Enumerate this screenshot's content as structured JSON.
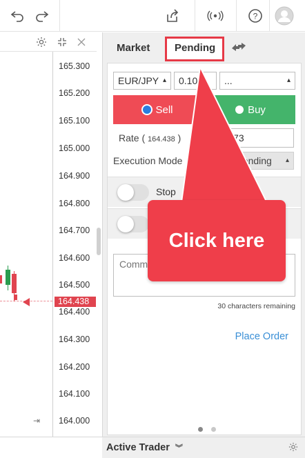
{
  "topbar": {
    "undo_icon": "undo-icon",
    "redo_icon": "redo-icon",
    "share_icon": "share-icon",
    "broadcast_icon": "broadcast-icon",
    "help_icon": "help-icon",
    "avatar_icon": "avatar-icon"
  },
  "chart": {
    "settings_icon": "gear-icon",
    "collapse_icon": "collapse-icon",
    "close_icon": "close-icon",
    "price_ticks": [
      "165.300",
      "165.200",
      "165.100",
      "165.000",
      "164.900",
      "164.800",
      "164.700",
      "164.600",
      "164.500",
      "164.400",
      "164.300",
      "164.200",
      "164.100",
      "164.000"
    ],
    "current_price": "164.438",
    "accent_color": "#e0444f"
  },
  "panel": {
    "tabs": [
      {
        "label": "Market"
      },
      {
        "label": "Pending"
      }
    ],
    "active_tab": "Pending",
    "pair": "EUR/JPY",
    "amount": "0.10",
    "third_select": "...",
    "sell_label": "Sell",
    "buy_label": "Buy",
    "sell_selected": true,
    "rate_label": "Rate (",
    "rate_value": "164.438",
    "rate_close": ")",
    "rate_input": "164.373",
    "execution_label": "Execution Mode",
    "execution_value": "Rate Pending",
    "stop_label": "Stop",
    "comment_placeholder": "Comment",
    "chars_remaining": "30 characters remaining",
    "place_order": "Place Order",
    "colors": {
      "sell": "#ef4b55",
      "buy": "#44b46b",
      "link": "#3a8fd6"
    }
  },
  "bottombar": {
    "title": "Active Trader",
    "settings_icon": "gear-icon"
  },
  "callout": {
    "text": "Click here",
    "color": "#ef3e4a"
  }
}
